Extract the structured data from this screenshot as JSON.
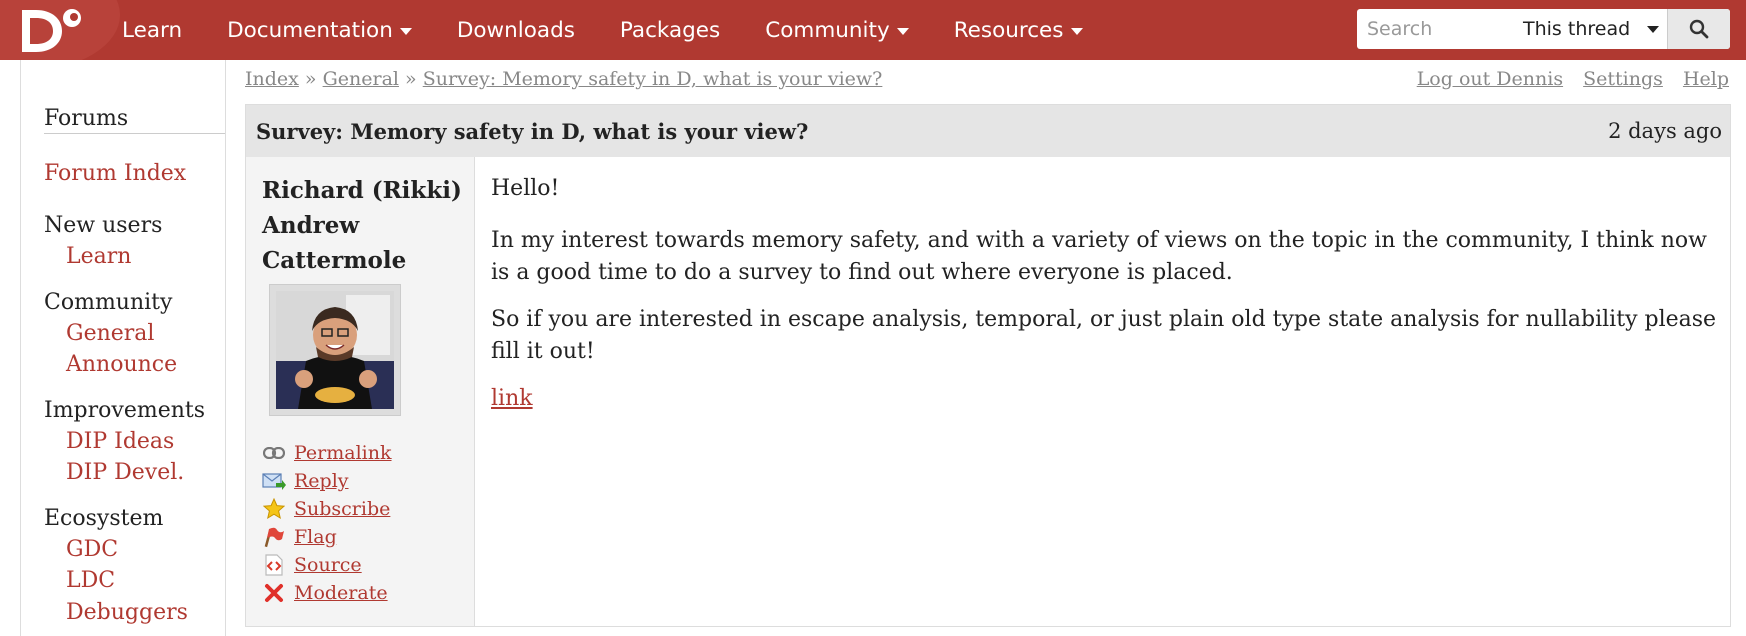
{
  "nav": {
    "items": [
      {
        "label": "Learn",
        "has_menu": false
      },
      {
        "label": "Documentation",
        "has_menu": true
      },
      {
        "label": "Downloads",
        "has_menu": false
      },
      {
        "label": "Packages",
        "has_menu": false
      },
      {
        "label": "Community",
        "has_menu": true
      },
      {
        "label": "Resources",
        "has_menu": true
      }
    ],
    "search": {
      "placeholder": "Search",
      "scope": "This thread"
    },
    "colors": {
      "bar": "#b03931",
      "link": "#b03931"
    }
  },
  "sidebar": {
    "heading": "Forums",
    "index_link": "Forum Index",
    "groups": [
      {
        "title": "New users",
        "links": [
          "Learn"
        ]
      },
      {
        "title": "Community",
        "links": [
          "General",
          "Announce"
        ]
      },
      {
        "title": "Improvements",
        "links": [
          "DIP Ideas",
          "DIP Devel."
        ]
      },
      {
        "title": "Ecosystem",
        "links": [
          "GDC",
          "LDC",
          "Debuggers"
        ]
      }
    ]
  },
  "breadcrumb": {
    "items": [
      "Index",
      "General",
      "Survey: Memory safety in D, what is your view?"
    ],
    "separator": "»"
  },
  "user_links": [
    "Log out Dennis",
    "Settings",
    "Help"
  ],
  "post": {
    "title": "Survey: Memory safety in D, what is your view?",
    "date": "2 days ago",
    "author": "Richard (Rikki) Andrew Cattermole",
    "actions": [
      {
        "label": "Permalink",
        "icon": "link-icon"
      },
      {
        "label": "Reply",
        "icon": "reply-icon"
      },
      {
        "label": "Subscribe",
        "icon": "star-icon"
      },
      {
        "label": "Flag",
        "icon": "flag-icon"
      },
      {
        "label": "Source",
        "icon": "source-icon"
      },
      {
        "label": "Moderate",
        "icon": "moderate-icon"
      }
    ],
    "body": {
      "greeting": "Hello!",
      "para1": "In my interest towards memory safety, and with a variety of views on the topic in the community, I think now is a good time to do a survey to find out where everyone is placed.",
      "para2": "So if you are interested in escape analysis, temporal, or just plain old type state analysis for nullability please fill it out!",
      "link": "link"
    }
  }
}
